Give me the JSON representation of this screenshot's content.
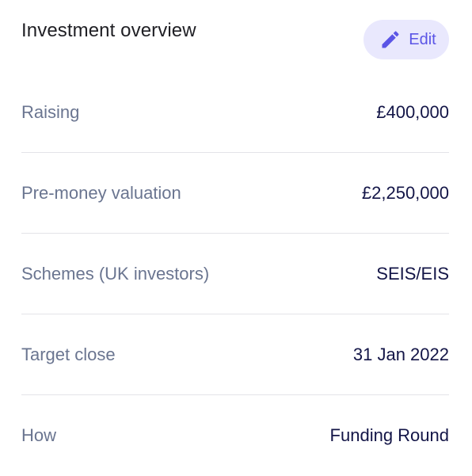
{
  "card": {
    "title": "Investment overview",
    "edit_button": {
      "label": "Edit",
      "icon": "pencil-icon",
      "accent_color": "#5b55e6",
      "background_color": "#e9e8fd"
    }
  },
  "rows": [
    {
      "label": "Raising",
      "value": "£400,000"
    },
    {
      "label": "Pre-money valuation",
      "value": "£2,250,000"
    },
    {
      "label": "Schemes (UK investors)",
      "value": "SEIS/EIS"
    },
    {
      "label": "Target close",
      "value": "31 Jan 2022"
    },
    {
      "label": "How",
      "value": "Funding Round"
    }
  ]
}
